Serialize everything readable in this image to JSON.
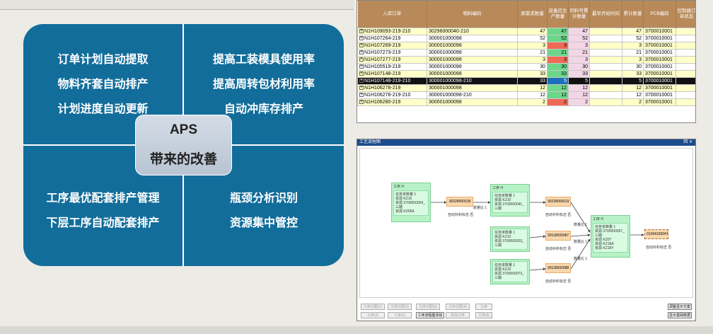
{
  "aps": {
    "title": "APS",
    "subtitle": "带来的改善",
    "top_left": [
      "订单计划自动提取",
      "物料齐套自动排产",
      "计划进度自动更新"
    ],
    "top_right": [
      "提高工装模具使用率",
      "提高周转包材利用率",
      "自动冲库存排产"
    ],
    "bottom_left": [
      "工序最优配套排产管理",
      "下层工序自动配套排产"
    ],
    "bottom_right": [
      "瓶颈分析识别",
      "资源集中管控"
    ]
  },
  "order_grid": {
    "headers": [
      "入库订单",
      "物料编码",
      "原需求数量",
      "设备应生产数量",
      "同料号累计数量",
      "最早开始时间",
      "累计数量",
      "PCB编码",
      "控制器订单状态",
      "工艺名"
    ],
    "rows": [
      {
        "order": "N1H109093-219-210",
        "material": "30296000040-210",
        "qty": "47",
        "prod": "47",
        "same": "47",
        "start": "",
        "cum": "47",
        "pcb": "3700010001",
        "state": "",
        "process": "",
        "style": "yellow",
        "prod_style": "green"
      },
      {
        "order": "N1H107264-219",
        "material": "300001000098",
        "qty": "52",
        "prod": "52",
        "same": "52",
        "start": "",
        "cum": "52",
        "pcb": "3700010001",
        "state": "",
        "process": "SA",
        "style": "white",
        "prod_style": "green"
      },
      {
        "order": "N1H107269-219",
        "material": "300001000098",
        "qty": "3",
        "prod": "3",
        "same": "3",
        "start": "",
        "cum": "3",
        "pcb": "3700010001",
        "state": "",
        "process": "SA",
        "style": "yellow",
        "prod_style": "red"
      },
      {
        "order": "N1H107273-219",
        "material": "300001000098",
        "qty": "21",
        "prod": "21",
        "same": "21",
        "start": "",
        "cum": "21",
        "pcb": "3700010001",
        "state": "",
        "process": "SA",
        "style": "white",
        "prod_style": "green"
      },
      {
        "order": "N1H107277-219",
        "material": "300001000098",
        "qty": "3",
        "prod": "3",
        "same": "3",
        "start": "",
        "cum": "3",
        "pcb": "3700010001",
        "state": "",
        "process": "SA",
        "style": "yellow",
        "prod_style": "red"
      },
      {
        "order": "N1H105519-219",
        "material": "300001000098",
        "qty": "30",
        "prod": "30",
        "same": "30",
        "start": "",
        "cum": "30",
        "pcb": "3700010001",
        "state": "",
        "process": "SA",
        "style": "white",
        "prod_style": "green"
      },
      {
        "order": "N1H107148-219",
        "material": "300001000098",
        "qty": "33",
        "prod": "33",
        "same": "33",
        "start": "",
        "cum": "33",
        "pcb": "3700010001",
        "state": "",
        "process": "SA",
        "style": "yellow",
        "prod_style": "green"
      },
      {
        "order": "N1H107148-219-210",
        "material": "300001000098-210",
        "qty": "33",
        "prod": "5",
        "same": "5",
        "start": "",
        "cum": "5",
        "pcb": "3700010001",
        "state": "",
        "process": "",
        "style": "selected",
        "prod_style": "blue"
      },
      {
        "order": "N1H106278-219",
        "material": "300001000098",
        "qty": "12",
        "prod": "12",
        "same": "12",
        "start": "",
        "cum": "12",
        "pcb": "3700010001",
        "state": "",
        "process": "SA",
        "style": "yellow",
        "prod_style": "green"
      },
      {
        "order": "N1H106278-219-210",
        "material": "300001000098-210",
        "qty": "12",
        "prod": "12",
        "same": "12",
        "start": "",
        "cum": "12",
        "pcb": "3700010001",
        "state": "",
        "process": "",
        "style": "white",
        "prod_style": "green"
      },
      {
        "order": "N1H106280-219",
        "material": "300001000098",
        "qty": "2",
        "prod": "2",
        "same": "2",
        "start": "",
        "cum": "2",
        "pcb": "3700010001",
        "state": "",
        "process": "SA",
        "style": "yellow",
        "prod_style": "red"
      }
    ]
  },
  "flow": {
    "window_title": "工艺流程图",
    "window_controls": "回 ✕",
    "nodes": [
      {
        "title": "工序 H",
        "sub": "任务单数量 1",
        "lines": [
          "资源 KZ10",
          "资源 3700000054_三期",
          "资源 KZ06A"
        ]
      },
      {
        "title": "工序 H",
        "sub": "任务单数量 1",
        "lines": [
          "资源 KZ10",
          "资源 3700000041_三期"
        ]
      },
      {
        "title": "",
        "sub": "任务单数量 1",
        "lines": [
          "资源 KZ10",
          "资源 3700000203_三期"
        ]
      },
      {
        "title": "",
        "sub": "任务单数量 1",
        "lines": [
          "资源 KZ10",
          "资源 3700000073_三期"
        ]
      },
      {
        "title": "工序 H",
        "sub": "任务单数量 1",
        "lines": [
          "资源 3700000057_三期",
          "资源 KZ07",
          "资源 KZ18A",
          "资源 KZ18Y"
        ]
      }
    ],
    "materials": [
      "30228000018",
      "30228000019",
      "30118000087",
      "30118000088",
      "01394100047"
    ],
    "qty_label": "数量比 1",
    "auto_label": "自动补料标志 否",
    "buttons": [
      "工序分配(1)",
      "工序分配(2)",
      "工序分配(3)",
      "工序分配(4)",
      "工序",
      "工序(2)",
      "工序(3)",
      "工序分配(5)",
      "工序流程图添加",
      "添加工序",
      "工序(6)"
    ],
    "right_buttons": [
      "调整显示方案",
      "显示基础数据"
    ]
  }
}
